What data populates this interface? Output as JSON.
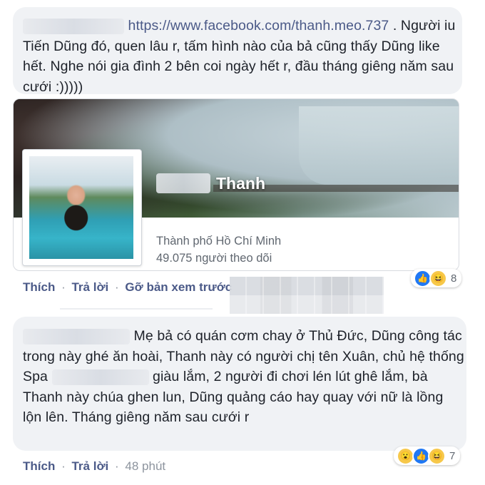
{
  "comment1": {
    "link": "https://www.facebook.com/thanh.meo.737",
    "text_after_link": " . Người iu Tiến Dũng đó, quen lâu r, tấm hình nào của bả cũng thấy Dũng like hết. Nghe nói gia đình 2 bên coi ngày hết r, đầu tháng giêng năm sau cưới :)))))"
  },
  "preview": {
    "page_name": "Thanh",
    "location": "Thành phố Hồ Chí Minh",
    "followers": "49.075 người theo dõi"
  },
  "actions1": {
    "like": "Thích",
    "sep1": "·",
    "reply": "Trả lời",
    "sep2": "·",
    "remove_preview": "Gỡ bản xem trước"
  },
  "reactions1": {
    "icons": [
      "like-icon",
      "haha-icon"
    ],
    "count": "8"
  },
  "comment2": {
    "text_part1": " Mẹ bả có quán cơm chay ở Thủ Đức, Dũng công tác trong này ghé ăn hoài, Thanh này có người chị tên Xuân, chủ hệ thống Spa ",
    "text_part2": " giàu lắm, 2 người đi chơi lén lút ghê lắm, bà Thanh này chúa ghen lun, Dũng quảng cáo hay quay với nữ là lồng lộn lên. Tháng giêng năm sau cưới r"
  },
  "actions2": {
    "like": "Thích",
    "sep1": "·",
    "reply": "Trả lời",
    "sep2": "·",
    "time": "48 phút"
  },
  "reactions2": {
    "icons": [
      "wow-icon",
      "like-icon",
      "haha-icon"
    ],
    "count": "7"
  }
}
